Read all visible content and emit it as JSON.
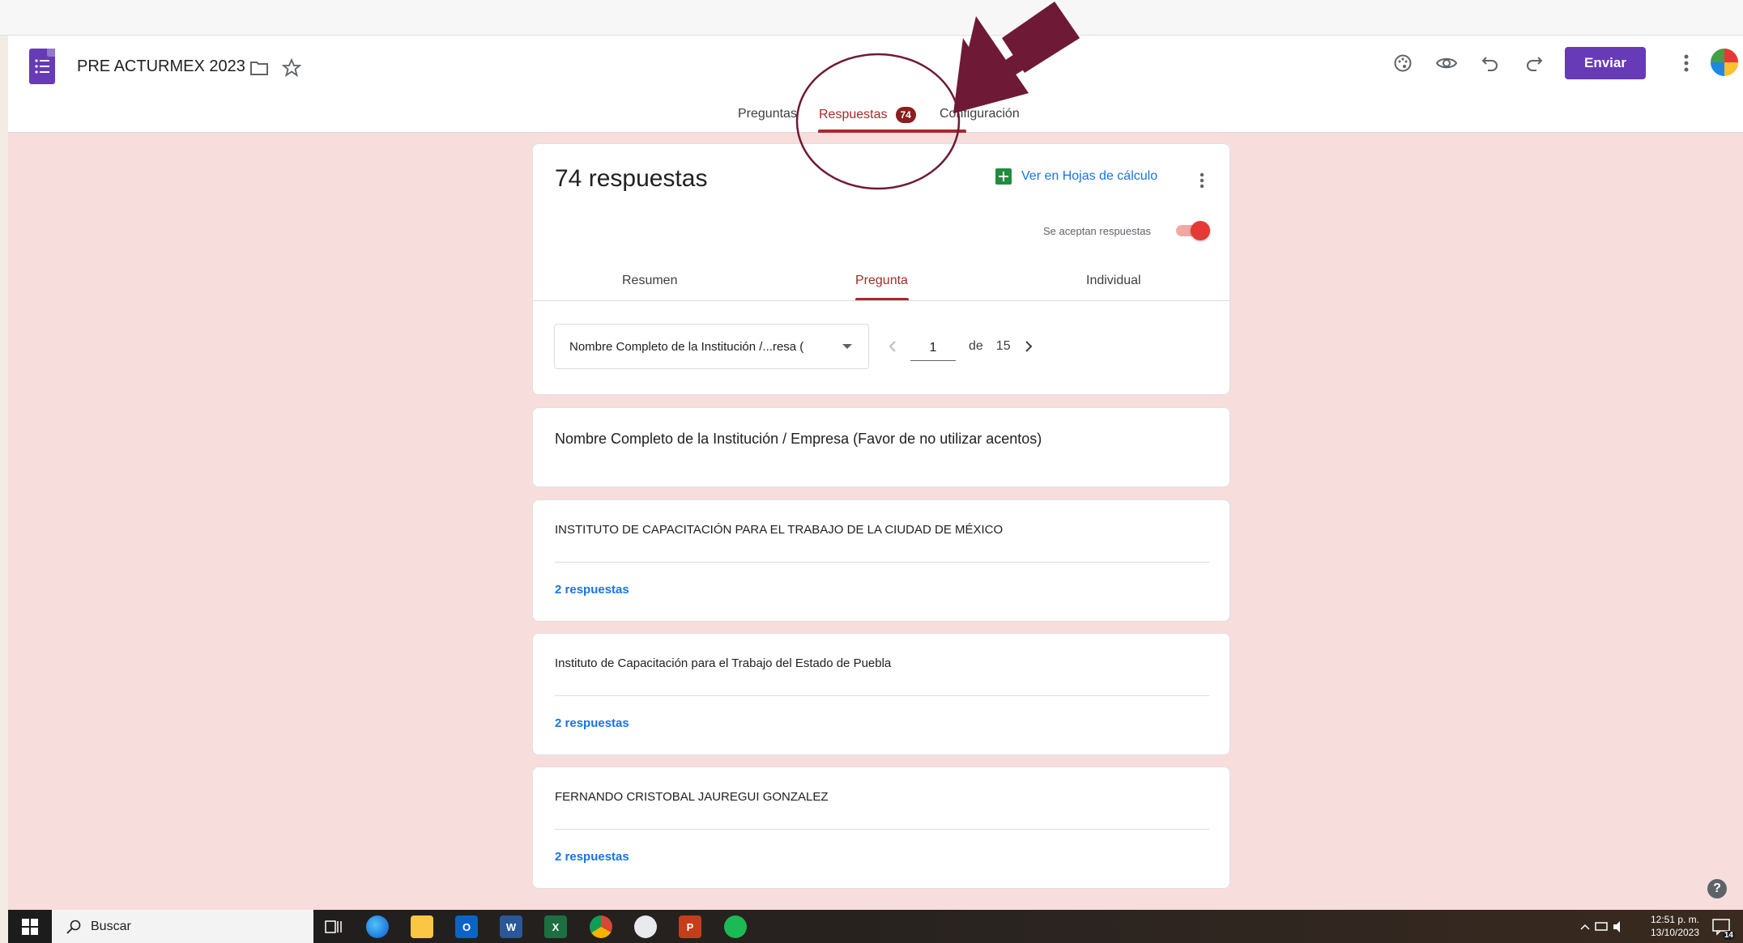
{
  "header": {
    "title": "PRE ACTURMEX 2023",
    "send_label": "Enviar",
    "tabs": [
      {
        "label": "Preguntas"
      },
      {
        "label": "Respuestas",
        "badge": "74"
      },
      {
        "label": "Configuración"
      }
    ]
  },
  "responses": {
    "count_title": "74 respuestas",
    "sheets_link": "Ver en Hojas de cálculo",
    "accepting_label": "Se aceptan respuestas",
    "sub_tabs": [
      {
        "label": "Resumen"
      },
      {
        "label": "Pregunta"
      },
      {
        "label": "Individual"
      }
    ],
    "question_select": "Nombre Completo de la Institución /...resa (",
    "pager": {
      "current": "1",
      "of_label": "de",
      "total": "15"
    },
    "question_title": "Nombre Completo de la Institución / Empresa (Favor de no utilizar acentos)",
    "answers": [
      {
        "text": "INSTITUTO DE CAPACITACIÓN PARA EL TRABAJO DE LA CIUDAD DE MÉXICO",
        "count": "2 respuestas"
      },
      {
        "text": "Instituto de Capacitación para el Trabajo del Estado de Puebla",
        "count": "2 respuestas"
      },
      {
        "text": "FERNANDO CRISTOBAL JAUREGUI GONZALEZ",
        "count": "2 respuestas"
      }
    ]
  },
  "help_label": "?",
  "taskbar": {
    "search_placeholder": "Buscar",
    "time": "12:51 p. m.",
    "date": "13/10/2023",
    "notification_count": "14"
  },
  "colors": {
    "brand_purple": "#673ab7",
    "accent_red": "#a52a2a",
    "background_pink": "#f8dddd",
    "annotation_maroon": "#6e1a36"
  }
}
